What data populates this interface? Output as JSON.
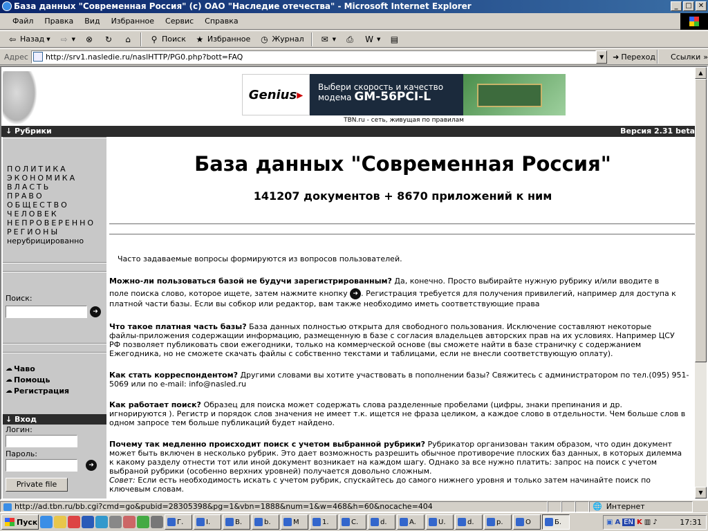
{
  "window": {
    "title": "База данных \"Современная Россия\" (с) ОАО \"Наследие отечества\" - Microsoft Internet Explorer",
    "btn_min": "_",
    "btn_max": "□",
    "btn_close": "✕"
  },
  "menu": [
    "Файл",
    "Правка",
    "Вид",
    "Избранное",
    "Сервис",
    "Справка"
  ],
  "toolbar": {
    "back": "Назад",
    "search": "Поиск",
    "favorites": "Избранное",
    "history": "Журнал"
  },
  "address": {
    "label": "Адрес",
    "url": "http://srv1.nasledie.ru/naslHTTP/PG0.php?bott=FAQ",
    "go": "Переход",
    "links": "Ссылки"
  },
  "page": {
    "banner": {
      "logo": "Genius",
      "line1": "Выбери скорость и качество",
      "line2": "модема",
      "model": "GM-56PCI-L"
    },
    "tbn": "TBN.ru - сеть, живущая по правилам",
    "rubrics_header": "Рубрики",
    "version": "Версия 2.31 beta",
    "rubrics": [
      "ПОЛИТИКА",
      "ЭКОНОМИКА",
      "ВЛАСТЬ",
      "ПРАВО",
      "ОБЩЕСТВО",
      "ЧЕЛОВЕК",
      "НЕПРОВЕРЕННО",
      "РЕГИОНЫ"
    ],
    "rubric_plain": "нерубрицированно",
    "search_label": "Поиск:",
    "links": [
      "Чаво",
      "Помощь",
      "Регистрация"
    ],
    "login_header": "Вход",
    "login_label": "Логин:",
    "password_label": "Пароль:",
    "private_file": "Private file",
    "heading": "База данных \"Современная Россия\"",
    "subheading": "141207 документов + 8670 приложений к ним",
    "intro": "Часто задаваемые вопросы формируются из вопросов пользователей.",
    "faq": [
      {
        "q": "Можно-ли пользоваться базой не будучи зарегистрированным?",
        "a1": " Да, конечно. Просто выбирайте нужную рубрику и/или вводите в",
        "a2": "поле поиска слово, которое ищете, затем нажмите кнопку",
        "a3": ". Регистрация требуется для получения привилегий, например для доступа к",
        "a4": "платной части базы. Если вы собкор или редактор, вам также необходимо иметь соответствующие права"
      },
      {
        "q": "Что такое платная часть базы?",
        "a1": " База данных полностью открыта для свободного пользования. Исключение составляют некоторые",
        "a2": "файлы-приложения содержащии информацию, размещенную в базе с согласия владельцев авторских прав на их условиях. Например ЦСУ",
        "a3": "РФ позволяет публиковать свои ежегодники, только на коммерческой основе (вы сможете найти в базе страничку с содержанием",
        "a4": "Ежегодника, но не сможете скачать файлы с собственно текстами и таблицами, если не внесли соответствующую оплату)."
      },
      {
        "q": "Как стать корреспондентом?",
        "a1": " Другими словами вы хотите участвовать в пополнении базы? Свяжитесь с администратором по тел.(095) 951-",
        "a2": "5069 или по e-mail: info@nasled.ru"
      },
      {
        "q": "Как работает поиск?",
        "a1": " Образец для поиска может содержать слова разделенные пробелами (цифры, знаки препинания и др.",
        "a2": "игнорируются ). Регистр и порядок слов значения не имеет т.к. ищется не фраза целиком, а каждое слово в отдельности. Чем больше слов в",
        "a3": "одном запросе тем больше публикаций будет найдено."
      },
      {
        "q": "Почему так медленно происходит поиск с учетом выбранной рубрики?",
        "a1": " Рубрикатор организован таким образом, что один документ",
        "a2": "может быть включен в несколько рубрик. Это дает возможность разрешить обычное противоречие плоских баз данных, в которых дилемма",
        "a3": "к какому разделу отнести тот или иной документ возникает на каждом шагу. Однако за все нужно платить: запрос на поиск с учетом",
        "a4": "выбраной рубрики (особенно верхних уровней) получается довольно сложным.",
        "tip_label": "Совет:",
        "tip": " Если есть необходимость искать с учетом рубрик, спускайтесь до самого нижнего уровня и только затем начинайте поиск по",
        "tip2": "ключевым словам."
      }
    ]
  },
  "status": {
    "url": "http://ad.tbn.ru/bb.cgi?cmd=go&pubid=28305398&pg=1&vbn=1888&num=1&w=468&h=60&nocache=404",
    "zone": "Интернет"
  },
  "taskbar": {
    "start": "Пуск",
    "tasks": [
      "Г.",
      "I.",
      "B.",
      "b.",
      "M",
      "1.",
      "C.",
      "d.",
      "A.",
      "U.",
      "d.",
      "p.",
      "O",
      "Б."
    ],
    "lang": "EN",
    "clock": "17:31"
  }
}
